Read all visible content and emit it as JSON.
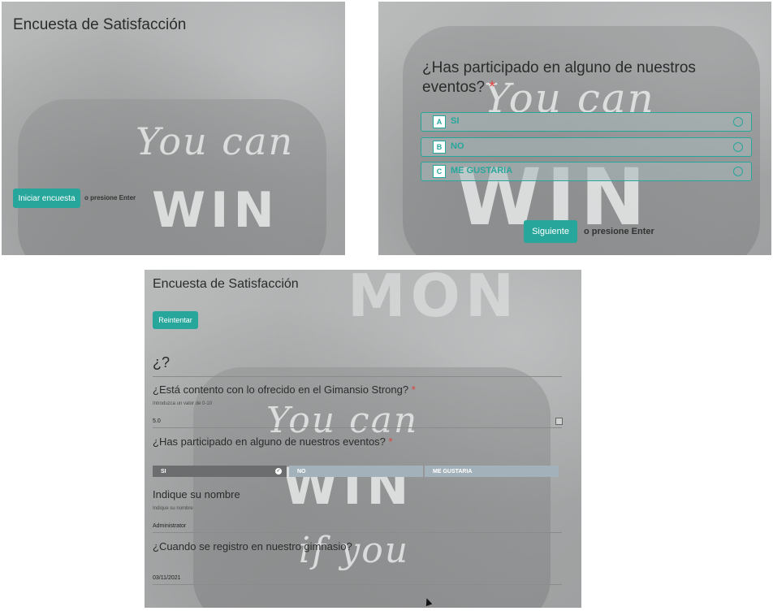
{
  "panel_start": {
    "title": "Encuesta de Satisfacción",
    "start_button": "Iniciar encuesta",
    "enter_hint": "o presione Enter"
  },
  "panel_question": {
    "question": "¿Has participado en alguno de nuestros eventos?",
    "required_mark": "*",
    "options": [
      {
        "key": "A",
        "label": "SI"
      },
      {
        "key": "B",
        "label": "NO"
      },
      {
        "key": "C",
        "label": "ME GUSTARIA"
      }
    ],
    "next_button": "Siguiente",
    "enter_hint": "o presione Enter"
  },
  "panel_review": {
    "title": "Encuesta de Satisfacción",
    "retry_button": "Reintentar",
    "section_heading": "¿?",
    "q1": {
      "label": "¿Está contento con lo ofrecido en el Gimansio Strong?",
      "required_mark": "*",
      "help": "Introduzca un valor de 0-10",
      "value": "5.0"
    },
    "q2": {
      "label": "¿Has participado en alguno de nuestros eventos?",
      "required_mark": "*",
      "segments": [
        "SI",
        "NO",
        "ME GUSTARIA"
      ],
      "selected": "SI"
    },
    "q3": {
      "label": "Indique su nombre",
      "help": "Indique su nombre",
      "value": "Administrator"
    },
    "q4": {
      "label": "¿Cuando se registro en nuestro gimnasio?",
      "value": "03/11/2021"
    }
  },
  "colors": {
    "accent": "#27a69b",
    "required": "#e0403c",
    "selected_segment": "#6b6d6e",
    "segment": "#a3b2ba"
  }
}
